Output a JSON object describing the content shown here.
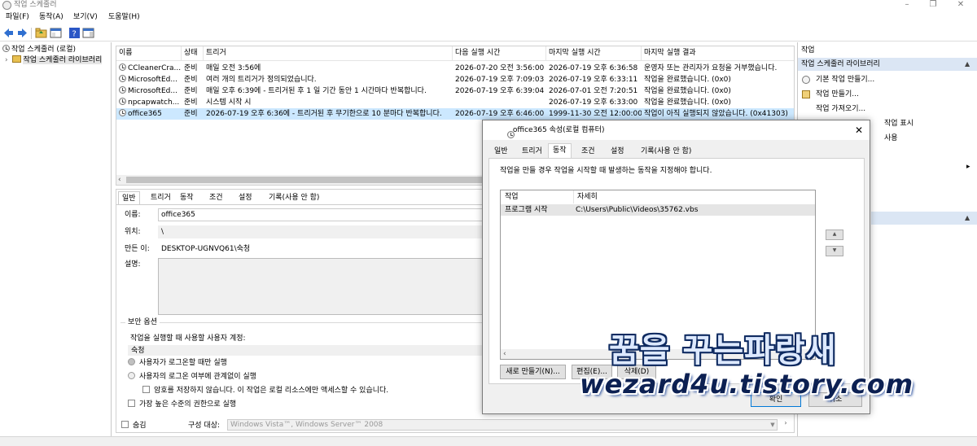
{
  "window": {
    "title": "작업 스케줄러"
  },
  "menu": {
    "items": [
      "파일(F)",
      "동작(A)",
      "보기(V)",
      "도움말(H)"
    ]
  },
  "tree": {
    "root": "작업 스케줄러 (로컬)",
    "child": "작업 스케줄러 라이브러리"
  },
  "task_list": {
    "columns": [
      "이름",
      "상태",
      "트리거",
      "다음 실행 시간",
      "마지막 실행 시간",
      "마지막 실행 결과"
    ],
    "rows": [
      {
        "name": "CCleanerCra...",
        "status": "준비",
        "trigger": "매일 오전 3:56에",
        "next": "2026-07-20 오전 3:56:00",
        "last": "2026-07-19 오후 6:36:58",
        "result": "운영자 또는 관리자가 요청을 거부했습니다."
      },
      {
        "name": "MicrosoftEd...",
        "status": "준비",
        "trigger": "여러 개의 트리거가 정의되었습니다.",
        "next": "2026-07-19 오후 7:09:03",
        "last": "2026-07-19 오후 6:33:11",
        "result": "작업을 완료했습니다. (0x0)"
      },
      {
        "name": "MicrosoftEd...",
        "status": "준비",
        "trigger": "매일 오후 6:39에 - 트리거된 후 1 일 기간 동안 1 시간마다 반복합니다.",
        "next": "2026-07-19 오후 6:39:04",
        "last": "2026-07-01 오전 7:20:51",
        "result": "작업을 완료했습니다. (0x0)"
      },
      {
        "name": "npcapwatch...",
        "status": "준비",
        "trigger": "시스템 시작 시",
        "next": "",
        "last": "2026-07-19 오후 6:33:00",
        "result": "작업을 완료했습니다. (0x0)"
      },
      {
        "name": "office365",
        "status": "준비",
        "trigger": "2026-07-19 오후 6:36에 - 트리거된 후 무기한으로 10 분마다 반복합니다.",
        "next": "2026-07-19 오후 6:46:00",
        "last": "1999-11-30 오전 12:00:00",
        "result": "작업이 아직 실행되지 않았습니다. (0x41303)"
      }
    ]
  },
  "details": {
    "tabs": [
      "일반",
      "트리거",
      "동작",
      "조건",
      "설정",
      "기록(사용 안 함)"
    ],
    "name_label": "이름:",
    "name_value": "office365",
    "location_label": "위치:",
    "location_value": "\\",
    "author_label": "만든 이:",
    "author_value": "DESKTOP-UGNVQ61\\숙청",
    "desc_label": "설명:",
    "security_title": "보안 옵션",
    "account_label": "작업을 실행할 때 사용할 사용자 계정:",
    "account_value": "숙청",
    "radio1": "사용자가 로그온할 때만 실행",
    "radio2": "사용자의 로그온 여부에 관계없이 실행",
    "no_password": "암호를 저장하지 않습니다. 이 작업은 로컬 리소스에만 액세스할 수 있습니다.",
    "highest": "가장 높은 수준의 권한으로 실행",
    "hidden_label": "숨김",
    "config_label": "구성 대상:",
    "config_value": "Windows Vista™, Windows Server™ 2008"
  },
  "actions_pane": {
    "header": "작업",
    "subheader": "작업 스케줄러 라이브러리",
    "items": [
      "기본 작업 만들기...",
      "작업 만들기...",
      "작업 가져오기...",
      "작업 표시",
      "사용"
    ]
  },
  "dialog": {
    "title": "office365 속성(로컬 컴퓨터)",
    "tabs": [
      "일반",
      "트리거",
      "동작",
      "조건",
      "설정",
      "기록(사용 안 함)"
    ],
    "description": "작업을 만들 경우 작업을 시작할 때 발생하는 동작을 지정해야 합니다.",
    "columns": [
      "작업",
      "자세히"
    ],
    "row": {
      "action": "프로그램 시작",
      "detail": "C:\\Users\\Public\\Videos\\35762.vbs"
    },
    "buttons": {
      "new": "새로 만들기(N)...",
      "edit": "편집(E)...",
      "delete": "삭제(D)",
      "ok": "확인",
      "cancel": "취소"
    }
  },
  "watermark": {
    "line1": "꿈을 꾸는파랑새",
    "line2": "wezard4u.tistory.com"
  },
  "colors": {
    "selection": "#cce8ff",
    "folder": "#e8c050",
    "help": "#2a56c6"
  }
}
